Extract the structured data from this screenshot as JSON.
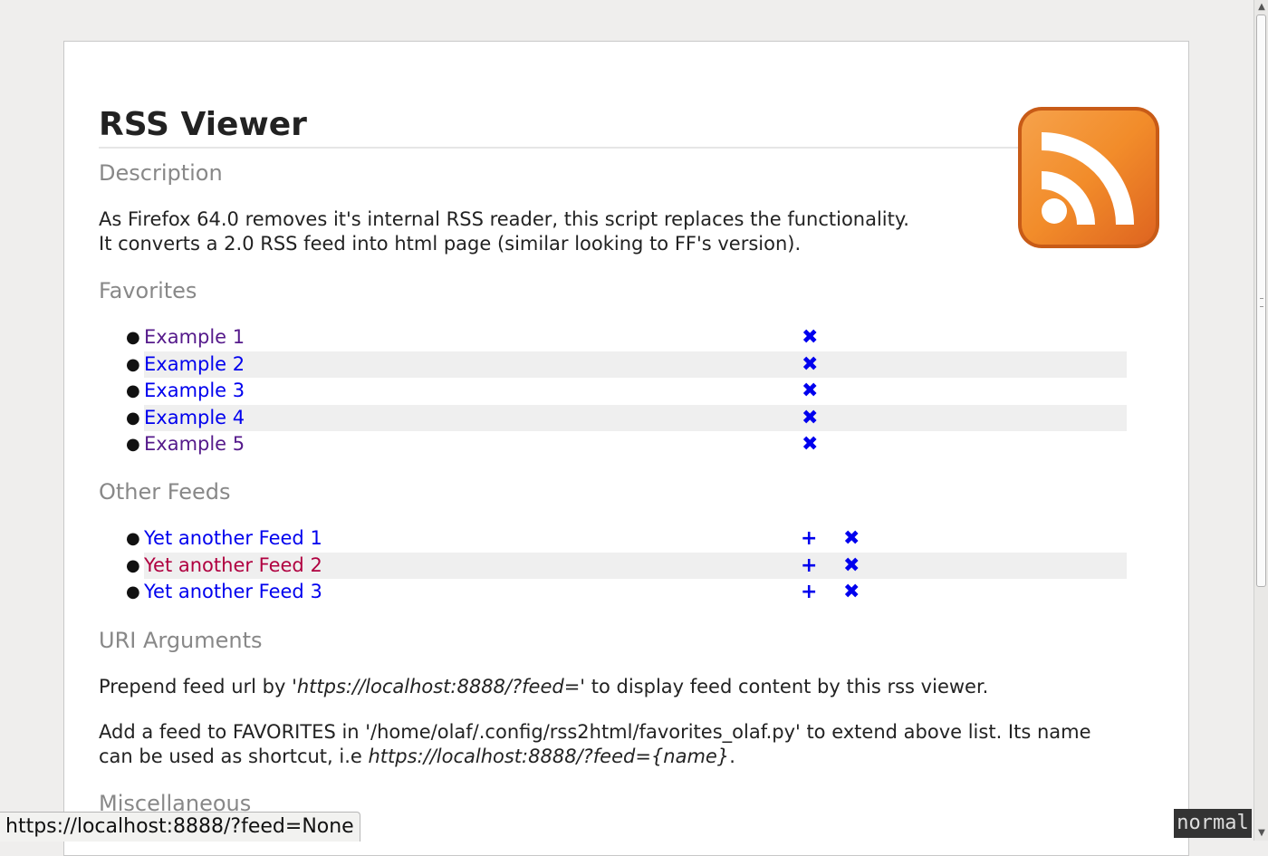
{
  "title": "RSS Viewer",
  "description": {
    "heading": "Description",
    "line1": "As Firefox 64.0 removes it's internal RSS reader, this script replaces the functionality.",
    "line2": "It converts a 2.0 RSS feed into html page (similar looking to FF's version)."
  },
  "favorites": {
    "heading": "Favorites",
    "items": [
      {
        "label": "Example 1",
        "remove": "✖"
      },
      {
        "label": "Example 2",
        "remove": "✖"
      },
      {
        "label": "Example 3",
        "remove": "✖"
      },
      {
        "label": "Example 4",
        "remove": "✖"
      },
      {
        "label": "Example 5",
        "remove": "✖"
      }
    ]
  },
  "other_feeds": {
    "heading": "Other Feeds",
    "items": [
      {
        "label": "Yet another Feed 1",
        "add": "+",
        "remove": "✖"
      },
      {
        "label": "Yet another Feed 2",
        "add": "+",
        "remove": "✖"
      },
      {
        "label": "Yet another Feed 3",
        "add": "+",
        "remove": "✖"
      }
    ]
  },
  "uri_arguments": {
    "heading": "URI Arguments",
    "p1_before": "Prepend feed url by '",
    "p1_em": "https://localhost:8888/?feed=",
    "p1_after": "' to display feed content by this rss viewer.",
    "p2_line1": "Add a feed to FAVORITES in '/home/olaf/.config/rss2html/favorites_olaf.py' to extend above list. Its name",
    "p2_before": "can be used as shortcut, i.e ",
    "p2_em": "https://localhost:8888/?feed={name}",
    "p2_after": "."
  },
  "miscellaneous": {
    "heading": "Miscellaneous"
  },
  "statusbar": {
    "url": "https://localhost:8888/?feed=None"
  },
  "mode_indicator": "normal",
  "colors": {
    "link": "#0000ee",
    "visited": "#551a8b",
    "active": "#b00040",
    "heading_gray": "#888888",
    "rss_orange": "#f08a24"
  }
}
